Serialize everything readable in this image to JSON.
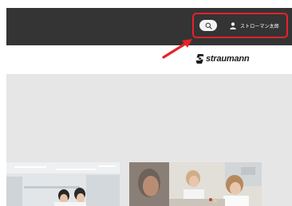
{
  "header": {
    "user_name": "ストローマン太郎"
  },
  "logo": {
    "brand": "straumann"
  },
  "icons": {
    "search": "search-icon",
    "user": "user-icon",
    "arrow": "arrow-icon",
    "logo_mark": "straumann-logo-mark"
  },
  "colors": {
    "topbar": "#343434",
    "highlight": "#e8222a",
    "content_background": "#e6e6e6"
  }
}
